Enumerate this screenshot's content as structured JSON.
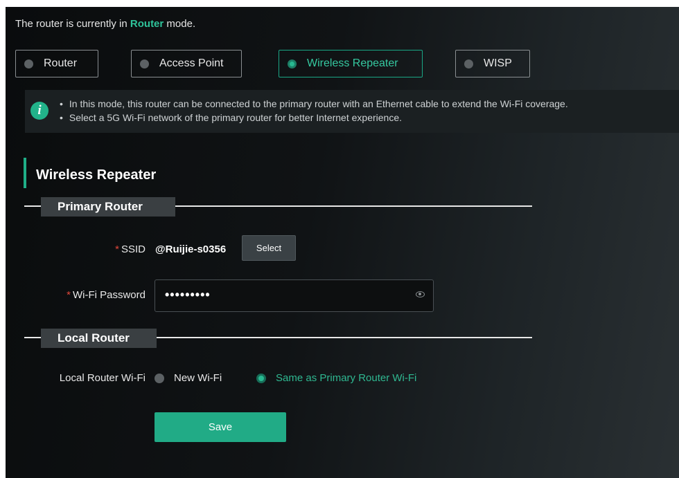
{
  "header": {
    "mode_prefix": "The router is currently in",
    "mode_value": "Router",
    "mode_suffix": "mode."
  },
  "modes": [
    {
      "label": "Router",
      "selected": false
    },
    {
      "label": "Access Point",
      "selected": false
    },
    {
      "label": "Wireless Repeater",
      "selected": true
    },
    {
      "label": "WISP",
      "selected": false
    }
  ],
  "info": {
    "icon": "info-icon",
    "lines": [
      "In this mode, this router can be connected to the primary router with an Ethernet cable to extend the Wi-Fi coverage.",
      "Select a 5G Wi-Fi network of the primary router for better Internet experience."
    ]
  },
  "section_title": "Wireless Repeater",
  "primary_router": {
    "legend": "Primary Router",
    "ssid_label": "SSID",
    "ssid_value": "@Ruijie-s0356",
    "select_label": "Select",
    "password_label": "Wi-Fi Password",
    "password_value": "•••••••••"
  },
  "local_router": {
    "legend": "Local Router",
    "wifi_label": "Local Router Wi-Fi",
    "options": [
      {
        "label": "New Wi-Fi",
        "selected": false
      },
      {
        "label": "Same as Primary Router Wi-Fi",
        "selected": true
      }
    ]
  },
  "save_label": "Save",
  "colors": {
    "accent": "#21ab86",
    "required": "#e0473b",
    "background": "#101315"
  }
}
